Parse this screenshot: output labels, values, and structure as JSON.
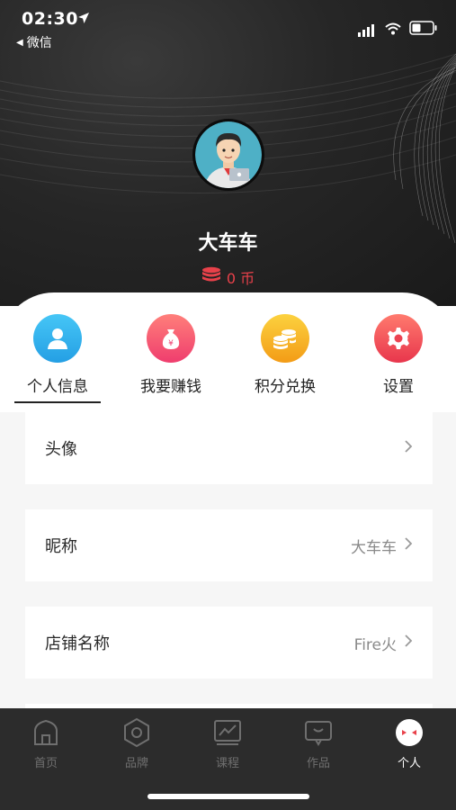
{
  "status_bar": {
    "time": "02:30",
    "back_app": "微信"
  },
  "profile": {
    "name": "大车车",
    "coins": "0 币"
  },
  "quick_menu": [
    {
      "label": "个人信息",
      "icon": "person-icon",
      "color": "#33b5f0"
    },
    {
      "label": "我要赚钱",
      "icon": "money-bag-icon",
      "color": "#f2546a"
    },
    {
      "label": "积分兑换",
      "icon": "coins-icon",
      "color": "#f6b21e"
    },
    {
      "label": "设置",
      "icon": "gear-icon",
      "color": "#ef4f5a"
    }
  ],
  "rows": [
    {
      "label": "头像",
      "value": ""
    },
    {
      "label": "昵称",
      "value": "大车车"
    },
    {
      "label": "店铺名称",
      "value": "Fire火"
    }
  ],
  "tabbar": [
    {
      "label": "首页",
      "icon": "home-icon"
    },
    {
      "label": "品牌",
      "icon": "hexagon-icon"
    },
    {
      "label": "课程",
      "icon": "chart-icon"
    },
    {
      "label": "作品",
      "icon": "works-icon"
    },
    {
      "label": "个人",
      "icon": "profile-icon"
    }
  ],
  "colors": {
    "accent": "#e8414a",
    "header_bg": "#262626",
    "tabbar_bg": "#2c2c2c"
  }
}
